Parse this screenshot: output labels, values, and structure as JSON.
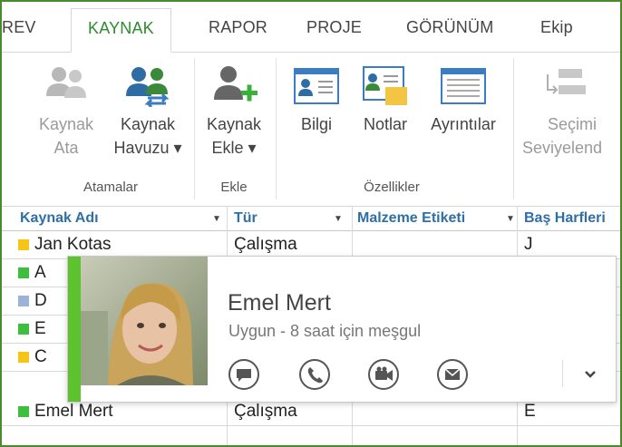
{
  "tabs": [
    {
      "label": "REV",
      "active": false
    },
    {
      "label": "KAYNAK",
      "active": true
    },
    {
      "label": "RAPOR",
      "active": false
    },
    {
      "label": "PROJE",
      "active": false
    },
    {
      "label": "GÖRÜNÜM",
      "active": false
    },
    {
      "label": "Ekip",
      "active": false
    }
  ],
  "ribbon": {
    "groups": {
      "atamalar": "Atamalar",
      "ekle": "Ekle",
      "ozellikler": "Özellikler"
    },
    "buttons": {
      "kaynak_ata": {
        "line1": "Kaynak",
        "line2": "Ata",
        "icon": "people-icon"
      },
      "kaynak_havuzu": {
        "line1": "Kaynak",
        "line2": "Havuzu ▾",
        "icon": "resource-pool-icon"
      },
      "kaynak_ekle": {
        "line1": "Kaynak",
        "line2": "Ekle ▾",
        "icon": "add-person-icon"
      },
      "bilgi": {
        "line1": "Bilgi",
        "icon": "info-card-icon"
      },
      "notlar": {
        "line1": "Notlar",
        "icon": "notes-icon"
      },
      "ayrintilar": {
        "line1": "Ayrıntılar",
        "icon": "details-icon"
      },
      "secimi": {
        "line1": "Seçimi",
        "line2": "Seviyelend",
        "icon": "level-icon"
      }
    }
  },
  "grid": {
    "columns": [
      {
        "label": "Kaynak Adı"
      },
      {
        "label": "Tür"
      },
      {
        "label": "Malzeme Etiketi"
      },
      {
        "label": "Baş Harfleri"
      }
    ],
    "rows": [
      {
        "name": "Jan Kotas",
        "type": "Çalışma",
        "initials": "J",
        "marker_color": "#f5c518"
      },
      {
        "name": "A",
        "type": "",
        "initials": "",
        "marker_color": "#3cbf3c"
      },
      {
        "name": "D",
        "type": "",
        "initials": "",
        "marker_color": "#9ab3d6"
      },
      {
        "name": "E",
        "type": "",
        "initials": "",
        "marker_color": "#3cbf3c"
      },
      {
        "name": "C",
        "type": "",
        "initials": "",
        "marker_color": "#f5c518"
      },
      {
        "name": "Emel Mert",
        "type": "Çalışma",
        "initials": "E",
        "marker_color": "#3cbf3c"
      }
    ]
  },
  "contact_card": {
    "name": "Emel Mert",
    "status": "Uygun - 8 saat için meşgul",
    "presence_color": "#5cc22e",
    "actions": [
      "im-icon",
      "phone-icon",
      "video-icon",
      "email-icon"
    ],
    "more": "chevron-down-icon"
  }
}
